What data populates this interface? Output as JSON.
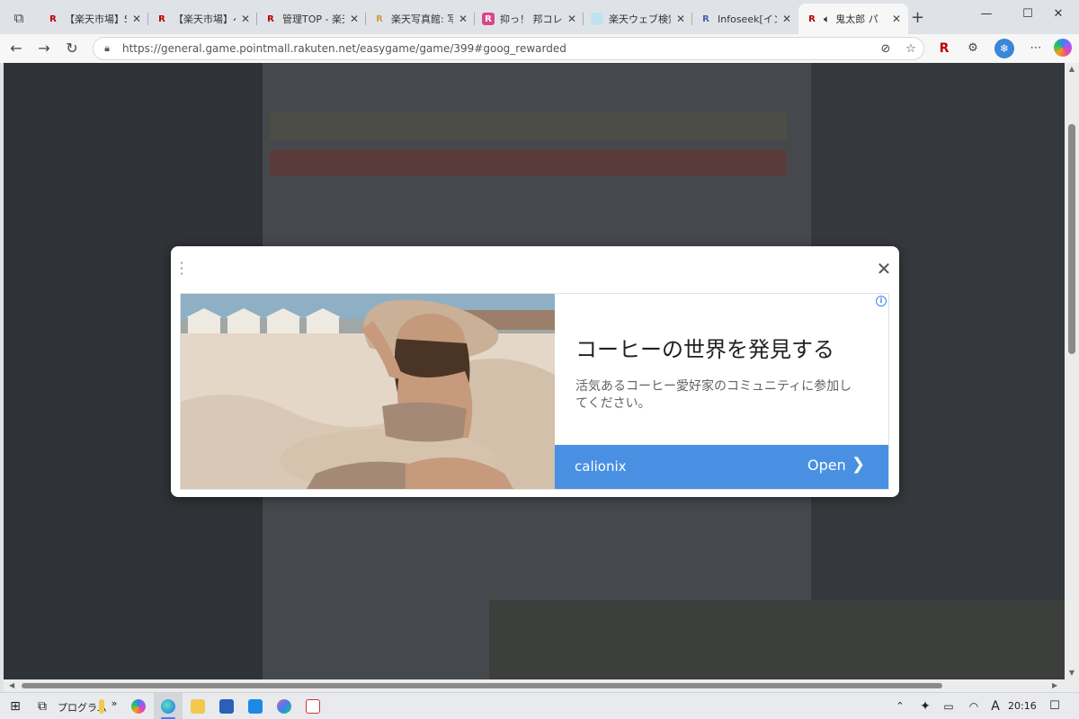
{
  "colors": {
    "tab_favicon_rakuten": "#bf0000",
    "cta_background": "#4a90e2",
    "dim_overlay": "#3a3d42"
  },
  "browser": {
    "tabs": [
      {
        "title": "【楽天市場】Sho",
        "favicon": "rakuten-icon"
      },
      {
        "title": "【楽天市場】ベ",
        "favicon": "rakuten-icon"
      },
      {
        "title": "管理TOP - 楽天",
        "favicon": "rakuten-icon"
      },
      {
        "title": "楽天写真館: 写",
        "favicon": "rakuten-icon"
      },
      {
        "title": "抑っ！ 邦コレも",
        "favicon": "rakuten-pink-icon"
      },
      {
        "title": "楽天ウェブ検索",
        "favicon": "search-icon"
      },
      {
        "title": "Infoseek[インフ",
        "favicon": "infoseek-icon"
      },
      {
        "title": "鬼太郎 パ",
        "favicon": "rakuten-icon",
        "active": true
      }
    ],
    "tab_close": "✕",
    "new_tab": "+",
    "url": "https://general.game.pointmall.rakuten.net/easygame/game/399#goog_rewarded",
    "window_controls": {
      "minimize": "—",
      "maximize": "☐",
      "close": "✕"
    }
  },
  "ad": {
    "headline": "コーヒーの世界を発見する",
    "description": "活気あるコーヒー愛好家のコミュニティに参加してください。",
    "advertiser": "calionix",
    "cta_label": "Open",
    "cta_chevron": "❯",
    "close_glyph": "✕",
    "adchoices": "i"
  },
  "taskbar": {
    "program_label": "プログラム",
    "overflow": "»",
    "clock": "20:16",
    "ime_indicator": "A"
  }
}
